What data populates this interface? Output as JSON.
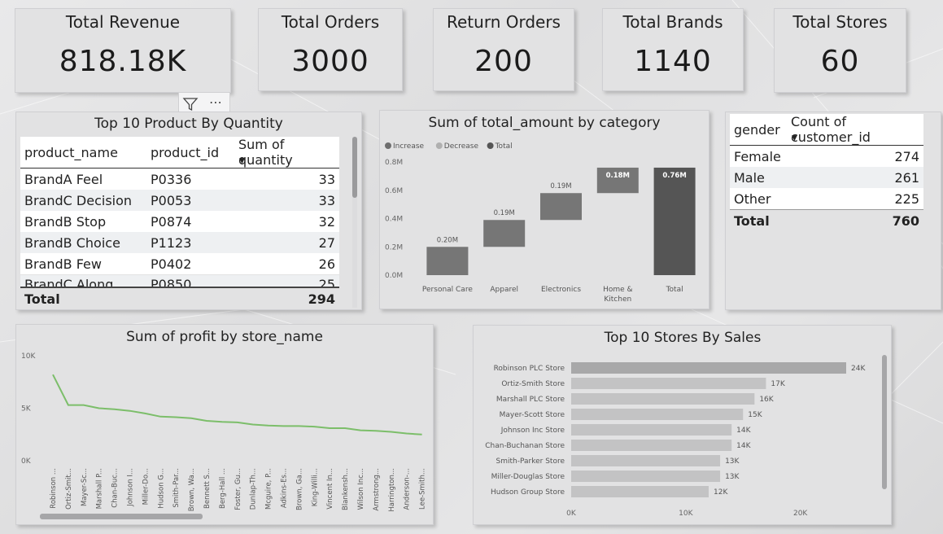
{
  "kpis": [
    {
      "title": "Total Revenue",
      "value": "818.18K"
    },
    {
      "title": "Total Orders",
      "value": "3000"
    },
    {
      "title": "Return Orders",
      "value": "200"
    },
    {
      "title": "Total Brands",
      "value": "1140"
    },
    {
      "title": "Total Stores",
      "value": "60"
    }
  ],
  "product_table": {
    "title": "Top 10 Product By Quantity",
    "columns": [
      "product_name",
      "product_id",
      "Sum of quantity"
    ],
    "rows": [
      [
        "BrandA Feel",
        "P0336",
        "33"
      ],
      [
        "BrandC Decision",
        "P0053",
        "33"
      ],
      [
        "BrandB Stop",
        "P0874",
        "32"
      ],
      [
        "BrandB Choice",
        "P1123",
        "27"
      ],
      [
        "BrandB Few",
        "P0402",
        "26"
      ],
      [
        "BrandC Along",
        "P0850",
        "25"
      ]
    ],
    "total_label": "Total",
    "total_value": "294"
  },
  "gender_table": {
    "columns": [
      "gender",
      "Count of customer_id"
    ],
    "rows": [
      [
        "Female",
        "274"
      ],
      [
        "Male",
        "261"
      ],
      [
        "Other",
        "225"
      ]
    ],
    "total_label": "Total",
    "total_value": "760"
  },
  "chart_data": [
    {
      "type": "bar",
      "subtype": "waterfall",
      "title": "Sum of total_amount by category",
      "legend": [
        "Increase",
        "Decrease",
        "Total"
      ],
      "legend_colors": [
        "#6e6e6e",
        "#b0b0b0",
        "#555555"
      ],
      "categories": [
        "Personal Care",
        "Apparel",
        "Electronics",
        "Home & Kitchen",
        "Total"
      ],
      "values": [
        0.2,
        0.19,
        0.19,
        0.18,
        0.76
      ],
      "data_labels": [
        "0.20M",
        "0.19M",
        "0.19M",
        "0.18M",
        "0.76M"
      ],
      "y_ticks": [
        "0.0M",
        "0.2M",
        "0.4M",
        "0.6M",
        "0.8M"
      ],
      "ylim": [
        0,
        0.8
      ]
    },
    {
      "type": "line",
      "title": "Sum of profit by store_name",
      "x": [
        "Robinson ...",
        "Ortiz-Smit...",
        "Mayer-Sc...",
        "Marshall P...",
        "Chan-Buc...",
        "Johnson I...",
        "Miller-Do...",
        "Hudson G...",
        "Smith-Par...",
        "Brown, Wa...",
        "Bennett S...",
        "Berg-Hall ...",
        "Foster, Gu...",
        "Dunlap-Th...",
        "Mcguire, P...",
        "Adkins-Es...",
        "Brown, Ga...",
        "King-Willi...",
        "Vincent In...",
        "Blankensh...",
        "Wilson Inc...",
        "Armstrong...",
        "Harrington...",
        "Anderson-...",
        "Lee-Smith..."
      ],
      "values": [
        8200,
        5300,
        5300,
        5000,
        4900,
        4750,
        4500,
        4200,
        4150,
        4050,
        3800,
        3700,
        3650,
        3450,
        3350,
        3300,
        3300,
        3250,
        3100,
        3100,
        2900,
        2850,
        2750,
        2600,
        2500
      ],
      "y_ticks": [
        "0K",
        "5K",
        "10K"
      ],
      "ylim": [
        0,
        10000
      ],
      "color": "#7cbe6a"
    },
    {
      "type": "bar",
      "orientation": "horizontal",
      "title": "Top 10 Stores By Sales",
      "categories": [
        "Robinson PLC Store",
        "Ortiz-Smith Store",
        "Marshall PLC Store",
        "Mayer-Scott Store",
        "Johnson Inc Store",
        "Chan-Buchanan Store",
        "Smith-Parker Store",
        "Miller-Douglas Store",
        "Hudson Group Store"
      ],
      "values": [
        24000,
        17000,
        16000,
        15000,
        14000,
        14000,
        13000,
        13000,
        12000
      ],
      "data_labels": [
        "24K",
        "17K",
        "16K",
        "15K",
        "14K",
        "14K",
        "13K",
        "13K",
        "12K"
      ],
      "x_ticks": [
        "0K",
        "10K",
        "20K"
      ],
      "xlim": [
        0,
        24000
      ],
      "bar_colors": [
        "#a8a8a9",
        "#c3c3c4"
      ]
    }
  ]
}
